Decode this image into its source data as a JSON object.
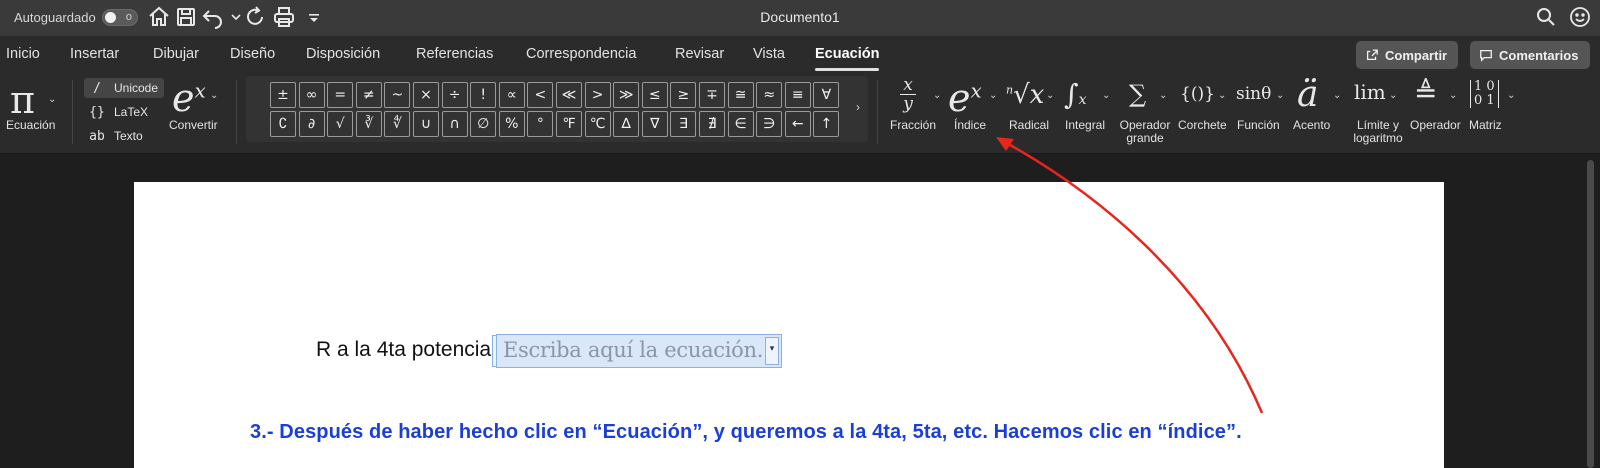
{
  "titlebar": {
    "autosave_label": "Autoguardado",
    "autosave_toggle_state": "o",
    "title": "Documento1"
  },
  "tabs": [
    {
      "label": "Inicio"
    },
    {
      "label": "Insertar"
    },
    {
      "label": "Dibujar"
    },
    {
      "label": "Diseño"
    },
    {
      "label": "Disposición"
    },
    {
      "label": "Referencias"
    },
    {
      "label": "Correspondencia"
    },
    {
      "label": "Revisar"
    },
    {
      "label": "Vista"
    },
    {
      "label": "Ecuación",
      "active": true
    }
  ],
  "actions": {
    "share_label": "Compartir",
    "comments_label": "Comentarios"
  },
  "ribbon": {
    "equation_label": "Ecuación",
    "modes": [
      {
        "icon": "/",
        "label": "Unicode",
        "selected": true
      },
      {
        "icon": "{}",
        "label": "LaTeX"
      },
      {
        "icon": "ab",
        "label": "Texto"
      }
    ],
    "convert_label": "Convertir",
    "symbols_row1": [
      "±",
      "∞",
      "=",
      "≠",
      "~",
      "×",
      "÷",
      "!",
      "∝",
      "<",
      "≪",
      ">",
      "≫",
      "≤",
      "≥",
      "∓",
      "≅",
      "≈",
      "≡",
      "∀"
    ],
    "symbols_row2": [
      "∁",
      "∂",
      "√",
      "∛",
      "∜",
      "∪",
      "∩",
      "∅",
      "%",
      "°",
      "℉",
      "℃",
      "∆",
      "∇",
      "∃",
      "∄",
      "∈",
      "∋",
      "←",
      "↑"
    ],
    "structures": [
      {
        "label": "Fracción"
      },
      {
        "label": "Índice"
      },
      {
        "label": "Radical"
      },
      {
        "label": "Integral"
      },
      {
        "label": "Operador grande"
      },
      {
        "label": "Corchete"
      },
      {
        "label": "Función"
      },
      {
        "label": "Acento"
      },
      {
        "label": "Límite y logaritmo"
      },
      {
        "label": "Operador"
      },
      {
        "label": "Matriz"
      }
    ]
  },
  "document": {
    "line_text": "R a la 4ta potencia",
    "equation_placeholder": "Escriba aquí la ecuación.",
    "instruction": "3.- Después de haber hecho clic en “Ecuación”, y queremos a la 4ta, 5ta, etc. Hacemos clic en “índice”."
  },
  "colors": {
    "instruction_text": "#1a3fd8",
    "annotation_arrow": "#e8261e",
    "equation_box_fill": "#d9e7f8"
  }
}
